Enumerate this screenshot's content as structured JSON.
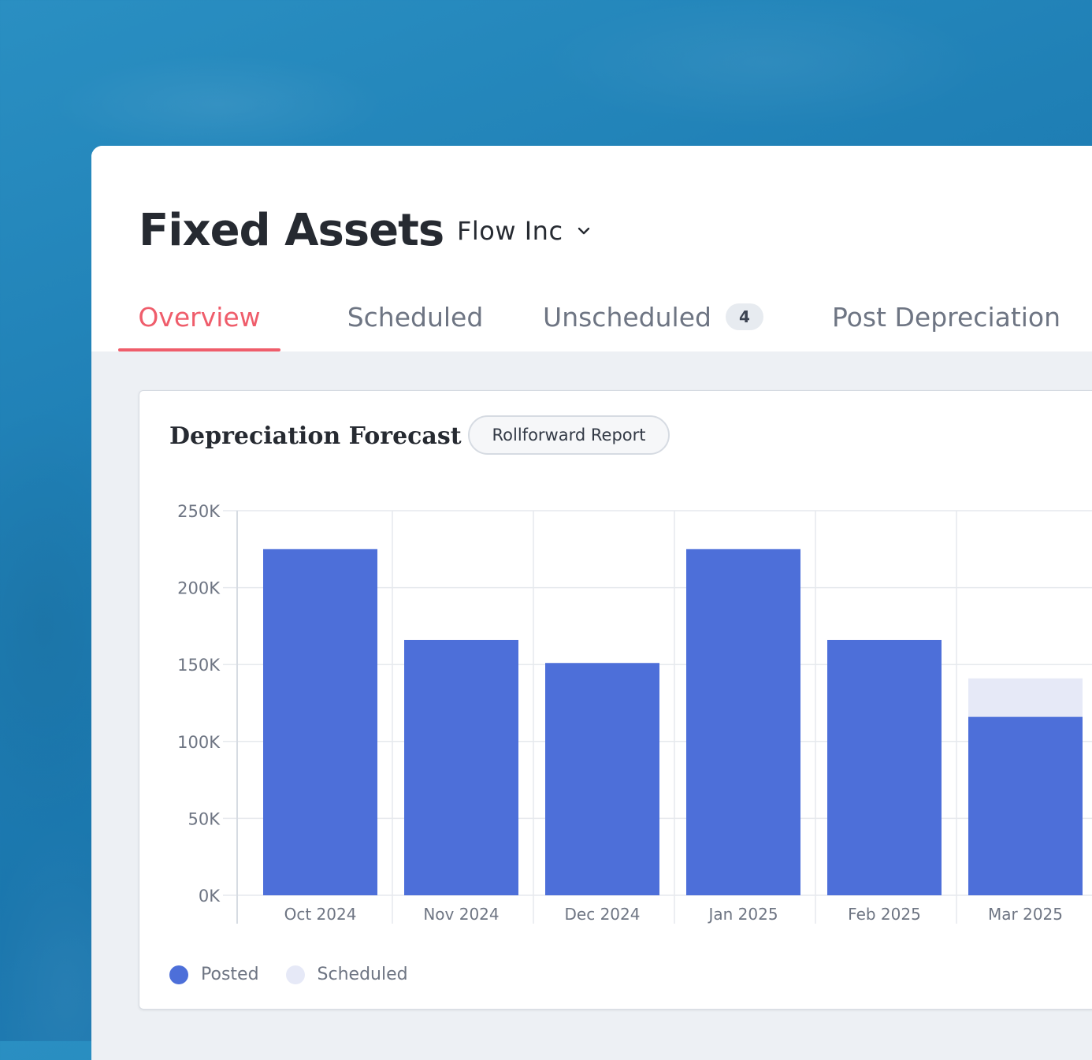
{
  "header": {
    "title": "Fixed Assets",
    "entity": {
      "name": "Flow Inc",
      "icon": "chevron-down-icon"
    }
  },
  "tabs": [
    {
      "label": "Overview",
      "active": true
    },
    {
      "label": "Scheduled",
      "active": false
    },
    {
      "label": "Unscheduled",
      "active": false,
      "badge": "4"
    },
    {
      "label": "Post Depreciation",
      "active": false
    }
  ],
  "card": {
    "title": "Depreciation Forecast",
    "report_button": "Rollforward Report"
  },
  "colors": {
    "posted": "#4d6fd9",
    "scheduled": "#e6e9f7",
    "accent": "#ef5d6b"
  },
  "chart_data": {
    "type": "bar",
    "stacked": true,
    "categories": [
      "Oct 2024",
      "Nov 2024",
      "Dec 2024",
      "Jan 2025",
      "Feb 2025",
      "Mar 2025"
    ],
    "series": [
      {
        "name": "Posted",
        "values": [
          225000,
          166000,
          151000,
          225000,
          166000,
          116000
        ]
      },
      {
        "name": "Scheduled",
        "values": [
          0,
          0,
          0,
          0,
          0,
          25000
        ]
      }
    ],
    "yticks": [
      "0K",
      "50K",
      "100K",
      "150K",
      "200K",
      "250K"
    ],
    "ylim": [
      0,
      250000
    ],
    "grid": true,
    "legend": "bottom-left"
  }
}
